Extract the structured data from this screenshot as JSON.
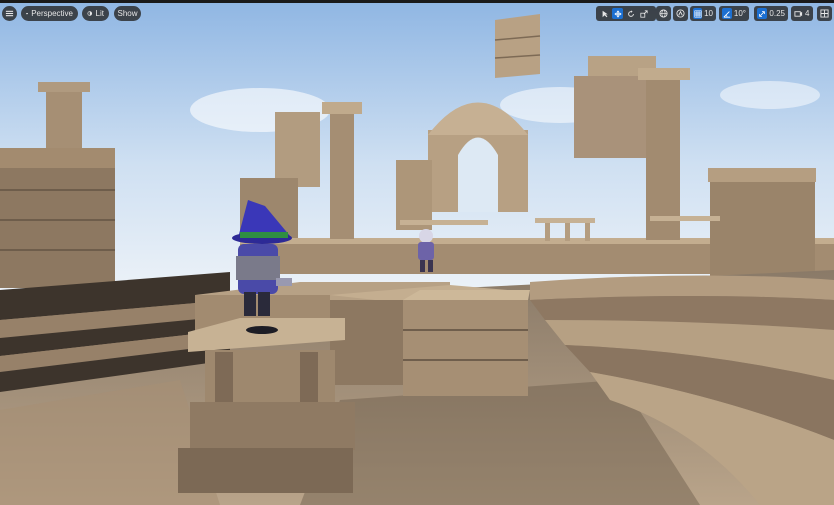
{
  "toolbar_left": {
    "view_mode_label": "Perspective",
    "lighting_label": "Lit",
    "show_label": "Show"
  },
  "toolbar_right": {
    "grid_snap_value": "10",
    "rotation_snap_value": "10°",
    "scale_snap_value": "0.25",
    "camera_speed_value": "4"
  },
  "colors": {
    "accent": "#1c6fd1",
    "toolbar_bg": "#282828",
    "sky_top": "#9fc0e6",
    "stone": "#b29a7c",
    "wizard_hat": "#3a37b8"
  },
  "icons": {
    "menu": "hamburger-icon",
    "view_mode": "camera-icon",
    "lighting": "sun-icon",
    "select": "cursor-icon",
    "translate": "move-icon",
    "rotate": "rotate-icon",
    "scale": "scale-icon",
    "world_local": "globe-icon",
    "surface_snap": "surface-snap-icon",
    "grid_snap": "grid-icon",
    "rotation_snap": "angle-icon",
    "scale_snap": "scale-snap-icon",
    "camera_speed": "camera-speed-icon",
    "maximize": "maximize-icon"
  }
}
